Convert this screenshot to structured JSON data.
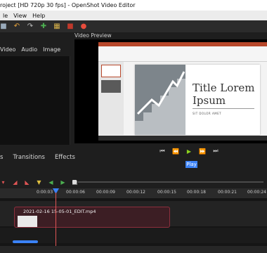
{
  "window": {
    "title": "roject [HD 720p 30 fps] - OpenShot Video Editor"
  },
  "menu": {
    "items": [
      "le",
      "View",
      "Help"
    ]
  },
  "left_panel": {
    "tabs": [
      "Video",
      "Audio",
      "Image"
    ]
  },
  "bottom_tabs": {
    "items": [
      "s",
      "Transitions",
      "Effects"
    ]
  },
  "preview": {
    "label": "Video Preview",
    "slide_title": "Title Lorem Ipsum",
    "slide_subtitle": "SIT DOLOR AMET"
  },
  "controls": {
    "tooltip": "Play"
  },
  "ruler": {
    "labels": [
      "0:00:03",
      "00:00:06",
      "00:00:09",
      "00:00:12",
      "00:00:15",
      "00:00:18",
      "00:00:21",
      "00:00:24"
    ]
  },
  "timeline": {
    "clip_name": "2021-02-16 15-05-01_EDIT.mp4"
  },
  "colors": {
    "play_green": "#8bd11f",
    "accent_blue": "#3b82f6",
    "playhead_red": "#e05555",
    "clip_border": "#8c2f3d"
  }
}
